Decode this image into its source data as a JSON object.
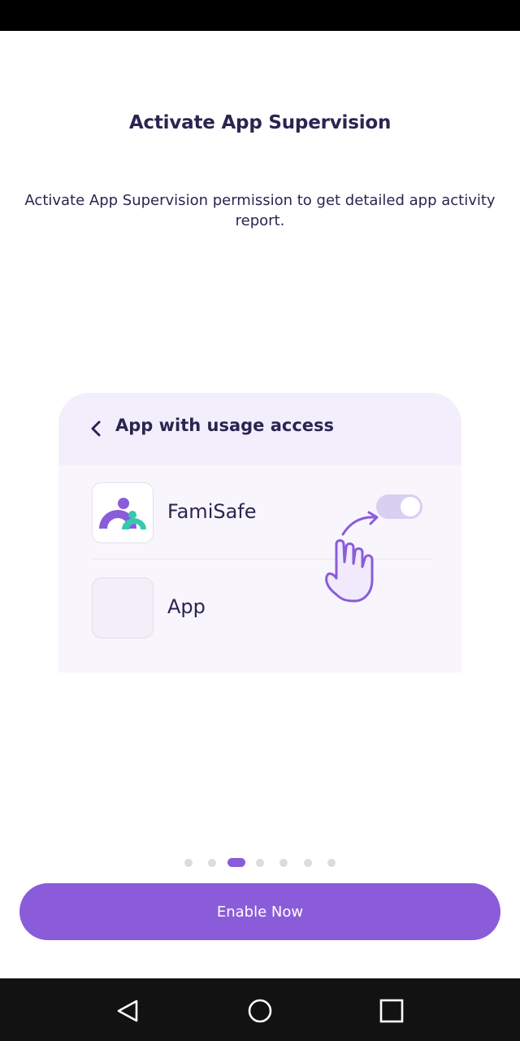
{
  "header": {
    "title": "Activate App Supervision",
    "description": "Activate App Supervision permission to get detailed app activity report."
  },
  "illustration": {
    "header_title": "App with usage access",
    "apps": [
      {
        "name": "FamiSafe",
        "icon": "famisafe-logo-icon",
        "toggle_on": true
      },
      {
        "name": "App",
        "icon": "blank-app-icon"
      }
    ]
  },
  "pager": {
    "total": 7,
    "active_index": 2
  },
  "actions": {
    "enable_label": "Enable Now"
  },
  "colors": {
    "accent": "#8b5cd9",
    "title_text": "#2a2550",
    "teal": "#37c8b0"
  },
  "system_nav": {
    "icons": [
      "back-icon",
      "home-icon",
      "recents-icon"
    ]
  }
}
